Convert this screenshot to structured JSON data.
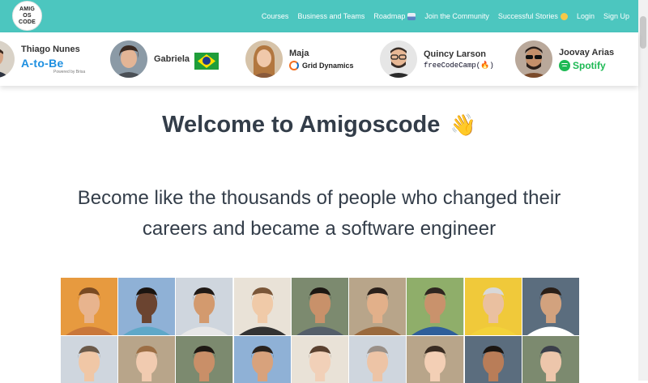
{
  "logo": {
    "line1": "AMIG",
    "line2": "OS",
    "line3": "CODE"
  },
  "nav": {
    "links": [
      {
        "label": "Courses",
        "emoji": ""
      },
      {
        "label": "Business and Teams",
        "emoji": ""
      },
      {
        "label": "Roadmap",
        "emoji": "roadmap-emoji"
      },
      {
        "label": "Join the Community",
        "emoji": ""
      },
      {
        "label": "Successful Stories",
        "emoji": "star-face-emoji"
      },
      {
        "label": "Login",
        "emoji": ""
      },
      {
        "label": "Sign Up",
        "emoji": ""
      }
    ]
  },
  "testimonials": [
    {
      "name": "Thiago Nunes",
      "company": "A-to-Be",
      "company_sub": "Powered by Brisa"
    },
    {
      "name": "Gabriela",
      "company": "Brazil flag"
    },
    {
      "name": "Maja",
      "company": "Grid Dynamics"
    },
    {
      "name": "Quincy Larson",
      "company": "freeCodeCamp(🔥)"
    },
    {
      "name": "Joovay Arias",
      "company": "Spotify"
    }
  ],
  "main": {
    "title": "Welcome to Amigoscode",
    "title_emoji": "👋",
    "subtitle": "Become like the thousands of people who changed their careers and became a software engineer"
  },
  "faces": {
    "count": 18,
    "colors": {
      "bg1": "#e79a3f",
      "bg2": "#8fb1d6",
      "bg3": "#cfd6de",
      "bg4": "#e9e2d7",
      "bg5": "#7c8a6f",
      "bg6": "#b8a58a",
      "bg7": "#8fae6a",
      "bg8": "#f0c93a",
      "bg9": "#5b6d7e"
    }
  },
  "colors": {
    "brand": "#4cc6bf",
    "text": "#333d49"
  }
}
